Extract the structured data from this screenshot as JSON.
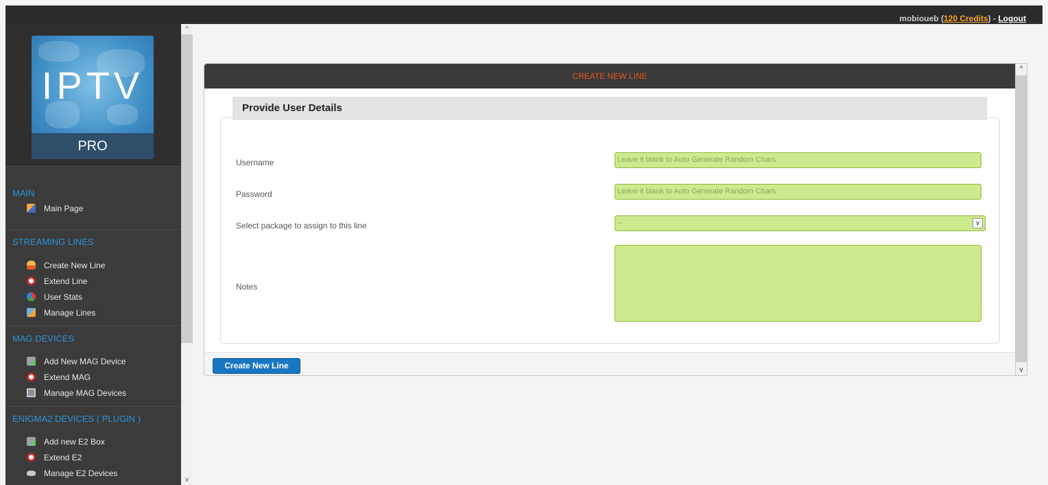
{
  "topbar": {
    "username": "mobioueb",
    "credits": "120 Credits",
    "logout": "Logout"
  },
  "logo": {
    "title": "IPTV",
    "subtitle": "PRO"
  },
  "sidebar": {
    "sections": [
      {
        "heading": "MAIN",
        "items": [
          {
            "label": "Main Page",
            "icon": "home-icon"
          }
        ]
      },
      {
        "heading": "STREAMING LINES",
        "items": [
          {
            "label": "Create New Line",
            "icon": "add-user-icon"
          },
          {
            "label": "Extend Line",
            "icon": "clock-icon"
          },
          {
            "label": "User Stats",
            "icon": "pie-chart-icon"
          },
          {
            "label": "Manage Lines",
            "icon": "user-wrench-icon"
          }
        ]
      },
      {
        "heading": "MAG DEVICES",
        "items": [
          {
            "label": "Add New MAG Device",
            "icon": "plug-add-icon"
          },
          {
            "label": "Extend MAG",
            "icon": "clock-icon"
          },
          {
            "label": "Manage MAG Devices",
            "icon": "monitor-icon"
          }
        ]
      },
      {
        "heading": "ENIGMA2 DEVICES ( PLUGIN )",
        "items": [
          {
            "label": "Add new E2 Box",
            "icon": "plug-add-icon"
          },
          {
            "label": "Extend E2",
            "icon": "clock-icon"
          },
          {
            "label": "Manage E2 Devices",
            "icon": "disk-icon"
          }
        ]
      }
    ]
  },
  "panel": {
    "header": "CREATE NEW LINE",
    "section_title": "Provide User Details",
    "fields": {
      "username_label": "Username",
      "username_placeholder": "Leave it blank to Auto Generate Random Chars",
      "password_label": "Password",
      "password_placeholder": "Leave it blank to Auto Generate Random Chars",
      "package_label": "Select package to assign to this line",
      "package_value": "--",
      "notes_label": "Notes",
      "notes_value": ""
    },
    "submit_label": "Create New Line"
  },
  "colors": {
    "accent": "#e8561f",
    "sidebar_heading": "#2e93d6",
    "field_bg": "#cdea8f",
    "button": "#1977c2",
    "credits": "#f5a623"
  }
}
